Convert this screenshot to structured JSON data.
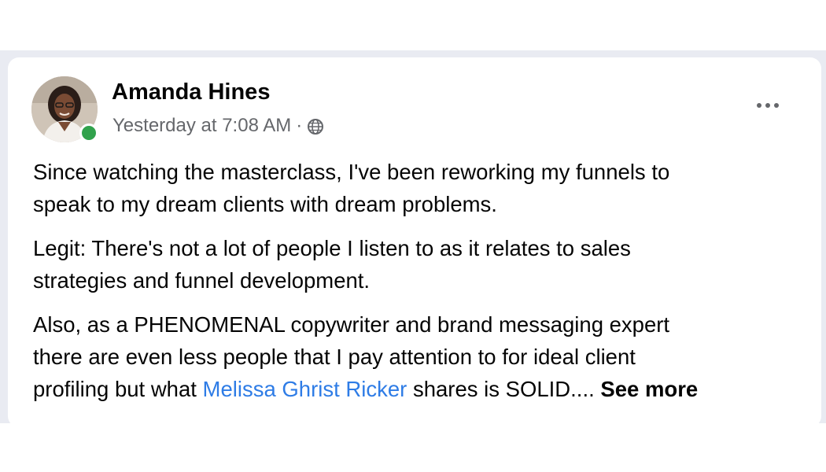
{
  "post": {
    "author": "Amanda Hines",
    "timestamp": "Yesterday at 7:08 AM",
    "separator": "·",
    "audience_icon": "globe-icon",
    "more_icon": "more-options-icon",
    "paragraphs": {
      "p1_line1": "Since watching the masterclass, I've been reworking my funnels to",
      "p1_line2": "speak to my dream clients with dream problems.",
      "p2_line1": "Legit: There's not a lot of people I listen to as it relates to sales",
      "p2_line2": "strategies and funnel development.",
      "p3_line1": "Also, as a PHENOMENAL copywriter and brand messaging expert",
      "p3_line2": "there are even less people that I pay attention to for ideal client",
      "p3_line3_before": "profiling but what ",
      "p3_mention": "Melissa Ghrist Ricker",
      "p3_line3_after": " shares is SOLID.... ",
      "see_more": "See more"
    }
  },
  "colors": {
    "page_band": "#e9ebf2",
    "card": "#ffffff",
    "text_primary": "#050505",
    "text_secondary": "#65676b",
    "mention_link": "#2e7ce6",
    "online_status": "#31a24c"
  }
}
